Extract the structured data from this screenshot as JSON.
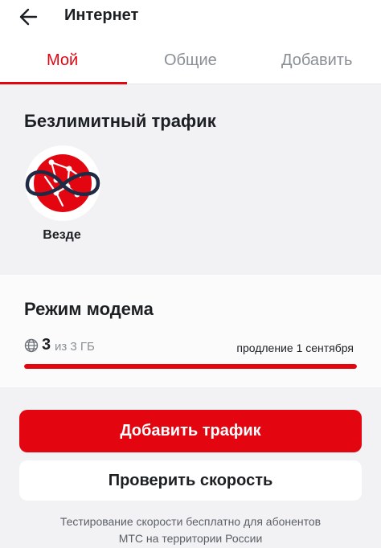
{
  "header": {
    "title": "Интернет",
    "back_icon": "arrow-left-icon"
  },
  "tabs": [
    {
      "label": "Мой",
      "active": true
    },
    {
      "label": "Общие",
      "active": false
    },
    {
      "label": "Добавить",
      "active": false
    }
  ],
  "unlimited": {
    "title": "Безлимитный трафик",
    "item_label": "Везде",
    "item_icon": "everywhere-globe-logo"
  },
  "modem": {
    "title": "Режим модема",
    "used": "3",
    "of_total": "из 3 ГБ",
    "renewal": "продление 1 сентября",
    "progress": 1.0
  },
  "actions": {
    "add_traffic": "Добавить трафик",
    "check_speed": "Проверить скорость"
  },
  "disclaimer": "Тестирование скорости бесплатно для абонентов МТС на территории России",
  "colors": {
    "accent": "#e30611",
    "text": "#1d2023",
    "muted": "#8a8f96"
  }
}
